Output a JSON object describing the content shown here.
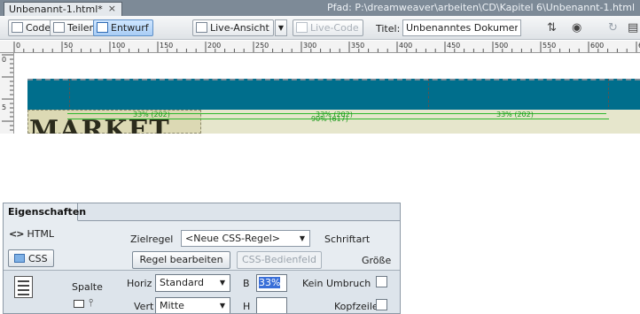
{
  "document": {
    "tab_title": "Unbenannt-1.html*",
    "tab_close": "×",
    "path": "Pfad:  P:\\dreamweaver\\arbeiten\\CD\\Kapitel 6\\Unbenannt-1.html"
  },
  "toolbar": {
    "code_label": "Code",
    "split_label": "Teilen",
    "design_label": "Entwurf",
    "live_view_label": "Live-Ansicht",
    "live_code_label": "Live-Code",
    "title_label": "Titel:",
    "title_value": "Unbenanntes Dokument",
    "file_mgmt_glyph": "⇅",
    "preview_glyph": "◉",
    "refresh_glyph": "↻",
    "options_glyph": "▤"
  },
  "rulers": {
    "h_labels": [
      "0",
      "50",
      "100",
      "150",
      "200",
      "250",
      "300",
      "350",
      "400",
      "450",
      "500",
      "550",
      "600",
      "650"
    ],
    "v_labels": [
      "0",
      "5"
    ]
  },
  "canvas": {
    "width_labels": [
      "33% (202)",
      "33% (202)",
      "33% (202)"
    ],
    "table_width_label": "90% (617)",
    "heading_text": "MARKET"
  },
  "properties": {
    "panel_tab": "Eigenschaften",
    "html_label": "HTML",
    "css_label": "CSS",
    "target_rule_label": "Zielregel",
    "target_rule_value": "<Neue CSS-Regel>",
    "edit_rule_button": "Regel bearbeiten",
    "css_panel_button": "CSS-Bedienfeld",
    "font_label": "Schriftart",
    "size_label": "Größe",
    "column_label": "Spalte",
    "horiz_label": "Horiz",
    "horiz_value": "Standard",
    "vert_label": "Vert",
    "vert_value": "Mitte",
    "w_label": "B",
    "w_value": "33%",
    "h_label": "H",
    "h_value": "",
    "nowrap_label": "Kein Umbruch",
    "header_label": "Kopfzeile"
  },
  "colors": {
    "tabbar": "#7d8a97",
    "header_band": "#006e8c",
    "page_background": "#e6e6cc",
    "guide_green": "#2cb82c",
    "selection": "#3a6fd8"
  }
}
